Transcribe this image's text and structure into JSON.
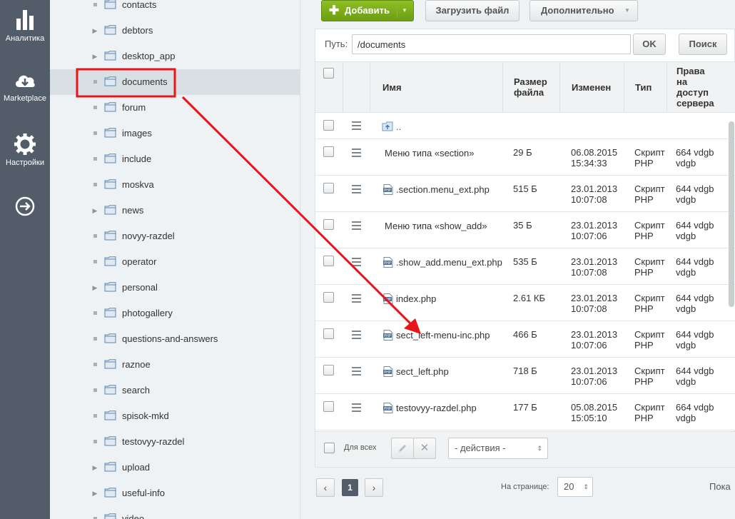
{
  "nav": {
    "items": [
      {
        "label": "Аналитика",
        "icon": "bar-chart-icon"
      },
      {
        "label": "Marketplace",
        "icon": "cloud-download-icon"
      },
      {
        "label": "Настройки",
        "icon": "gear-icon"
      },
      {
        "label": "",
        "icon": "arrow-right-circle-icon"
      }
    ]
  },
  "tree": {
    "items": [
      {
        "label": "contacts",
        "expandable": false
      },
      {
        "label": "debtors",
        "expandable": true
      },
      {
        "label": "desktop_app",
        "expandable": true
      },
      {
        "label": "documents",
        "expandable": false,
        "selected": true
      },
      {
        "label": "forum",
        "expandable": false
      },
      {
        "label": "images",
        "expandable": false
      },
      {
        "label": "include",
        "expandable": false
      },
      {
        "label": "moskva",
        "expandable": false
      },
      {
        "label": "news",
        "expandable": true
      },
      {
        "label": "novyy-razdel",
        "expandable": false
      },
      {
        "label": "operator",
        "expandable": false
      },
      {
        "label": "personal",
        "expandable": true
      },
      {
        "label": "photogallery",
        "expandable": false
      },
      {
        "label": "questions-and-answers",
        "expandable": false
      },
      {
        "label": "raznoe",
        "expandable": false
      },
      {
        "label": "search",
        "expandable": false
      },
      {
        "label": "spisok-mkd",
        "expandable": false
      },
      {
        "label": "testovyy-razdel",
        "expandable": false
      },
      {
        "label": "upload",
        "expandable": true
      },
      {
        "label": "useful-info",
        "expandable": true
      },
      {
        "label": "video",
        "expandable": false
      }
    ]
  },
  "toolbar": {
    "add_label": "Добавить",
    "upload_label": "Загрузить файл",
    "more_label": "Дополнительно"
  },
  "path": {
    "label": "Путь:",
    "value": "/documents",
    "ok_label": "OK",
    "search_label": "Поиск"
  },
  "table": {
    "headers": {
      "name": "Имя",
      "size": "Размер файла",
      "modified": "Изменен",
      "type": "Тип",
      "rights": "Права на доступ сервера"
    },
    "up_label": "..",
    "rows": [
      {
        "name": "Меню типа «section»",
        "size": "29 Б",
        "date": "06.08.2015",
        "time": "15:34:33",
        "type1": "Скрипт",
        "type2": "PHP",
        "r1": "664 vdgb",
        "r2": "vdgb",
        "icon": "none"
      },
      {
        "name": ".section.menu_ext.php",
        "size": "515 Б",
        "date": "23.01.2013",
        "time": "10:07:08",
        "type1": "Скрипт",
        "type2": "PHP",
        "r1": "644 vdgb",
        "r2": "vdgb",
        "icon": "php"
      },
      {
        "name": "Меню типа «show_add»",
        "size": "35 Б",
        "date": "23.01.2013",
        "time": "10:07:06",
        "type1": "Скрипт",
        "type2": "PHP",
        "r1": "644 vdgb",
        "r2": "vdgb",
        "icon": "none"
      },
      {
        "name": ".show_add.menu_ext.php",
        "size": "535 Б",
        "date": "23.01.2013",
        "time": "10:07:08",
        "type1": "Скрипт",
        "type2": "PHP",
        "r1": "644 vdgb",
        "r2": "vdgb",
        "icon": "php"
      },
      {
        "name": "index.php",
        "size": "2.61 КБ",
        "date": "23.01.2013",
        "time": "10:07:08",
        "type1": "Скрипт",
        "type2": "PHP",
        "r1": "644 vdgb",
        "r2": "vdgb",
        "icon": "php"
      },
      {
        "name": "sect_left-menu-inc.php",
        "size": "466 Б",
        "date": "23.01.2013",
        "time": "10:07:06",
        "type1": "Скрипт",
        "type2": "PHP",
        "r1": "644 vdgb",
        "r2": "vdgb",
        "icon": "php"
      },
      {
        "name": "sect_left.php",
        "size": "718 Б",
        "date": "23.01.2013",
        "time": "10:07:06",
        "type1": "Скрипт",
        "type2": "PHP",
        "r1": "644 vdgb",
        "r2": "vdgb",
        "icon": "php"
      },
      {
        "name": "testovyy-razdel.php",
        "size": "177 Б",
        "date": "05.08.2015",
        "time": "15:05:10",
        "type1": "Скрипт",
        "type2": "PHP",
        "r1": "664 vdgb",
        "r2": "vdgb",
        "icon": "php"
      }
    ],
    "footer": {
      "for_all_label": "Для всех",
      "actions_value": "- действия -"
    }
  },
  "pager": {
    "current": "1",
    "per_page_label": "На странице:",
    "per_page_value": "20",
    "show_label": "Пока"
  },
  "colors": {
    "nav_bg": "#535c69",
    "add_green": "#7aab17",
    "highlight_red": "#e8141a"
  }
}
